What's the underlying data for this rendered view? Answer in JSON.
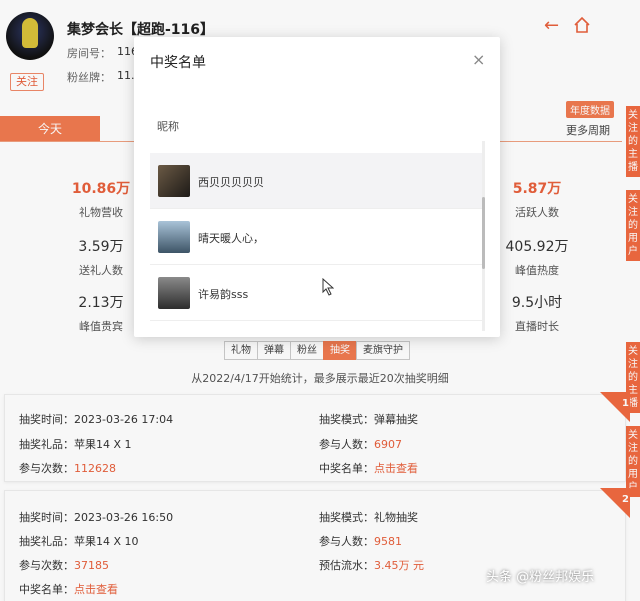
{
  "header": {
    "anchor_name": "集梦会长【超跑-116】",
    "follow_label": "关注",
    "room_label": "房间号：",
    "room_value": "116",
    "fans_label": "粉丝牌：",
    "fans_value": "11."
  },
  "tabs": {
    "today": "今天",
    "annual_badge": "年度数据",
    "more_period": "更多周期"
  },
  "stats": [
    {
      "value": "10.86万",
      "label": "礼物营收",
      "highlight": true
    },
    {
      "value": "5.87万",
      "label": "活跃人数",
      "highlight": true
    },
    {
      "value": "3.59万",
      "label": "送礼人数",
      "highlight": false
    },
    {
      "value": "405.92万",
      "label": "峰值热度",
      "highlight": false
    },
    {
      "value": "2.13万",
      "label": "峰值贵宾",
      "highlight": false
    },
    {
      "value": "9.5小时",
      "label": "直播时长",
      "highlight": false
    }
  ],
  "ribbons": [
    {
      "text": [
        "关",
        "注",
        "的",
        "主",
        "播"
      ]
    },
    {
      "text": [
        "关",
        "注",
        "的",
        "用",
        "户"
      ]
    },
    {
      "text": [
        "关",
        "注",
        "的",
        "主",
        "播"
      ]
    },
    {
      "text": [
        "关",
        "注",
        "的",
        "用",
        "户"
      ]
    }
  ],
  "filter_tags": [
    "礼物",
    "弹幕",
    "粉丝",
    "抽奖",
    "麦旗守护"
  ],
  "active_tag": "抽奖",
  "stats_note": "从2022/4/17开始统计，最多展示最近20次抽奖明细",
  "lottery": [
    {
      "index": "1",
      "time_label": "抽奖时间：",
      "time": "2023-03-26 17:04",
      "mode_label": "抽奖模式：",
      "mode": "弹幕抽奖",
      "gift_label": "抽奖礼品：",
      "gift": "苹果14 X 1",
      "people_label": "参与人数：",
      "people": "6907",
      "count_label": "参与次数：",
      "count": "112628",
      "winners_label": "中奖名单：",
      "winners_link": "点击查看"
    },
    {
      "index": "2",
      "time_label": "抽奖时间：",
      "time": "2023-03-26 16:50",
      "mode_label": "抽奖模式：",
      "mode": "礼物抽奖",
      "gift_label": "抽奖礼品：",
      "gift": "苹果14 X 10",
      "people_label": "参与人数：",
      "people": "9581",
      "count_label": "参与次数：",
      "count": "37185",
      "flow_label": "预估流水：",
      "flow": "3.45万 元",
      "winners_label": "中奖名单：",
      "winners_link": "点击查看"
    }
  ],
  "modal": {
    "title": "中奖名单",
    "close": "×",
    "column": "昵称",
    "winners": [
      {
        "name": "西贝贝贝贝贝"
      },
      {
        "name": "晴天暖人心，"
      },
      {
        "name": "许易韵sss"
      }
    ]
  },
  "watermark": "头条 @粉丝邦娱乐",
  "colors": {
    "accent": "#f07a50",
    "highlight": "#e8603c",
    "ribbon": "#f06a40"
  }
}
